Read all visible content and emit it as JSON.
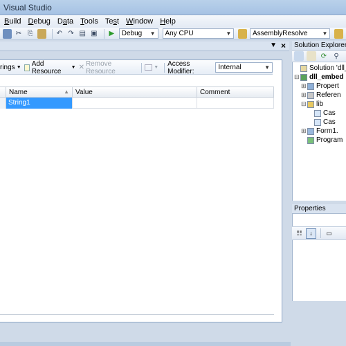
{
  "window": {
    "title": "Visual Studio"
  },
  "menu": [
    {
      "label": "Build",
      "accel": "B"
    },
    {
      "label": "Debug",
      "accel": "D"
    },
    {
      "label": "Data",
      "accel": "a"
    },
    {
      "label": "Tools",
      "accel": "T"
    },
    {
      "label": "Test",
      "accel": "s"
    },
    {
      "label": "Window",
      "accel": "W"
    },
    {
      "label": "Help",
      "accel": "H"
    }
  ],
  "toolbar": {
    "configuration": "Debug",
    "platform": "Any CPU",
    "startup_project": "AssemblyResolve"
  },
  "resource_editor": {
    "type_dropdown": "rings",
    "add_resource": "Add Resource",
    "remove_resource": "Remove Resource",
    "access_modifier_label": "Access Modifier:",
    "access_modifier_value": "Internal",
    "columns": [
      "Name",
      "Value",
      "Comment"
    ],
    "rows": [
      {
        "name": "String1",
        "value": "",
        "comment": ""
      }
    ]
  },
  "solution_explorer": {
    "title": "Solution Explorer - d",
    "nodes": [
      {
        "label": "Solution 'dll_e",
        "level": 0,
        "expander": ""
      },
      {
        "label": "dll_embed",
        "level": 0,
        "expander": "⊟",
        "bold": true
      },
      {
        "label": "Propert",
        "level": 1,
        "expander": "⊞"
      },
      {
        "label": "Referen",
        "level": 1,
        "expander": "⊞"
      },
      {
        "label": "lib",
        "level": 1,
        "expander": "⊟"
      },
      {
        "label": "Cas",
        "level": 2,
        "expander": ""
      },
      {
        "label": "Cas",
        "level": 2,
        "expander": ""
      },
      {
        "label": "Form1.",
        "level": 1,
        "expander": "⊞"
      },
      {
        "label": "Program",
        "level": 1,
        "expander": ""
      }
    ]
  },
  "properties": {
    "title": "Properties"
  }
}
